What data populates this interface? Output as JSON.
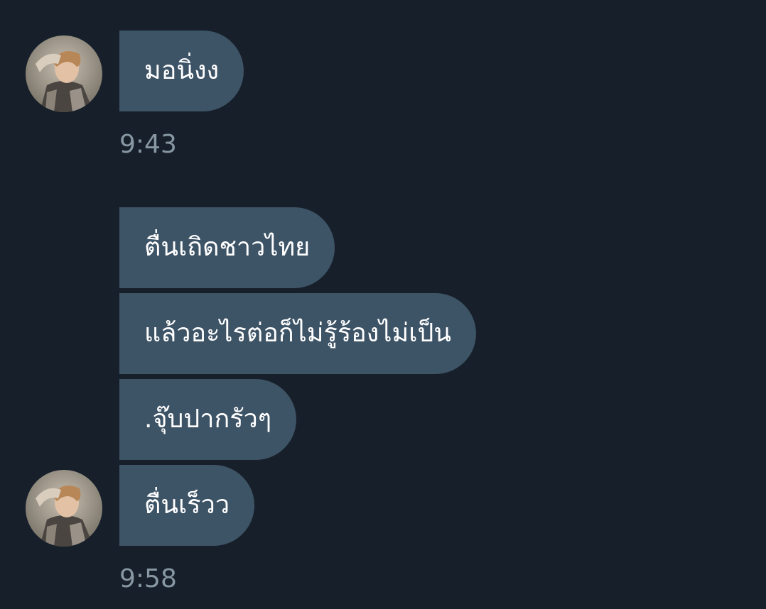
{
  "conversation": {
    "groups": [
      {
        "messages": [
          {
            "text": "มอนิ่งง"
          }
        ],
        "time": "9:43"
      },
      {
        "messages": [
          {
            "text": "ตื่นเถิดชาวไทย"
          },
          {
            "text": "แล้วอะไรต่อก็ไม่รู้ร้องไม่เป็น"
          },
          {
            "text": ".จุ๊บปากรัวๆ"
          },
          {
            "text": "ตื่นเร็วว"
          }
        ],
        "time": "9:58"
      }
    ]
  },
  "colors": {
    "background": "#17202a",
    "bubble": "#3d5366",
    "message_text": "#ffffff",
    "timestamp_text": "#8797a3"
  },
  "icons": {
    "avatar": "user-avatar-photo"
  }
}
